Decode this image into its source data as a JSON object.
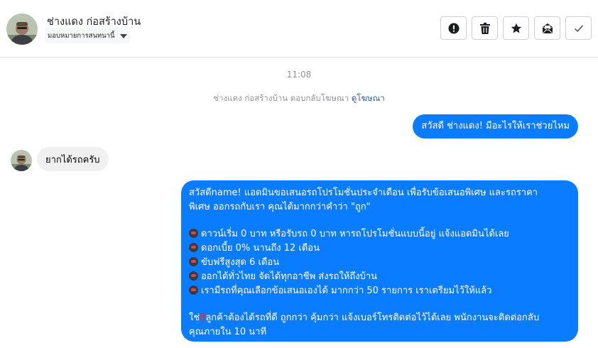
{
  "header": {
    "contact_name": "ช่างแดง ก่อสร้างบ้าน",
    "assign_label": "มอบหมายการสนทนานี้"
  },
  "toolbar": {
    "buttons": [
      {
        "name": "report",
        "icon": "exclamation-icon"
      },
      {
        "name": "delete",
        "icon": "trash-icon"
      },
      {
        "name": "star",
        "icon": "star-icon"
      },
      {
        "name": "mark-unread",
        "icon": "envelope-icon"
      },
      {
        "name": "done",
        "icon": "checkmark-icon"
      }
    ]
  },
  "conversation": {
    "timestamp": "11:08",
    "ad_reply_text": "ช่างแดง ก่อสร้างบ้าน ตอบกลับโฆษณา",
    "ad_reply_link": "ดูโฆษณา",
    "outgoing_1": "สวัสดี ช่างแดง! มีอะไรให้เราช่วยไหม",
    "incoming_1": "ยากได้รถครับ",
    "outgoing_2": {
      "line1": "สวัสดีname! แอดมินขอเสนอรถโปรโมชั่นประจำเดือน เพื่อรับข้อเสนอพิเศษ และรถราคา",
      "line2": "พิเศษ ออกรถกับเรา คุณได้มากกว่าคำว่า \"ถูก\"",
      "bullets": [
        "ดาวน์เริ่ม 0 บาท หรือรับรถ 0 บาท หารถโปรโมชั่นแบบนี้อยู่ แจ้งแอดมินได้เลย",
        "ดอกเบี้ย 0% นานถึง 12 เดือน",
        "ขับฟรีสูงสุด 6 เดือน",
        "ออกได้ทั่วไทย จัดได้ทุกอาชีพ ส่งรถให้ถึงบ้าน",
        "เรามีรถที่คุณเลือกข้อเสนอเองได้ มากกว่า 50 รายการ เราเตรียมไว้ให้แล้ว"
      ],
      "closing_prefix": "ใช่",
      "closing_mark": "‼",
      "closing_rest": "ลูกค้าต้องได้รถที่ดี ถูกกว่า คุ้มกว่า แจ้งเบอร์โทรติดต่อไว้ได้เลย พนักงานจะติดต่อกลับ",
      "closing_line2": "คุณภายใน 10 นาที"
    }
  },
  "colors": {
    "outgoing_bubble": "#0a7cff",
    "incoming_bubble": "#f1f0f0",
    "link": "#385898"
  }
}
